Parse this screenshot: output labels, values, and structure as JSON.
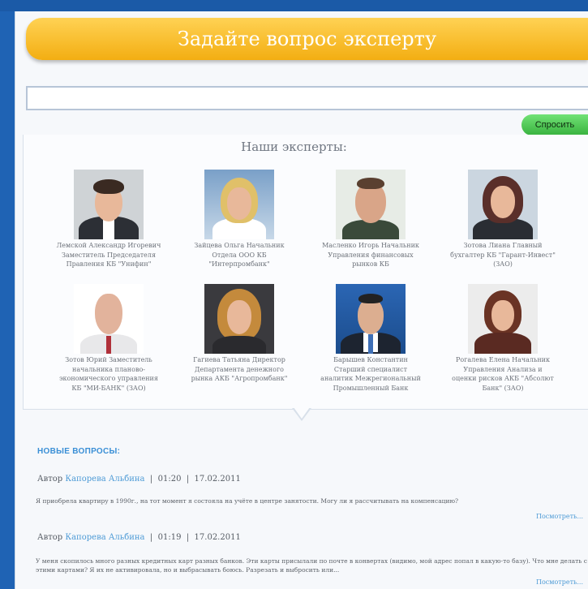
{
  "header": {
    "title": "Задайте вопрос эксперту"
  },
  "search": {
    "placeholder": "",
    "ask_label": "Спросить"
  },
  "experts_section": {
    "heading": "Наши эксперты:"
  },
  "experts": [
    {
      "caption": "Лемской Александр Игоревич Заместитель Председателя Правления КБ \"Унифин\""
    },
    {
      "caption": "Зайцева Ольга Начальник Отдела ООО КБ \"Интерпромбанк\""
    },
    {
      "caption": "Масленко Игорь Начальник Управления финансовых рынков КБ"
    },
    {
      "caption": "Зотова Лиана Главный бухгалтер КБ \"Гарант-Инвест\"(ЗАО)"
    },
    {
      "caption": "Зотов Юрий Заместитель начальника планово-экономического управления КБ \"МИ-БАНК\" (ЗАО)"
    },
    {
      "caption": "Гагиева Татьяна Директор Департамента денежного рынка АКБ \"Агропромбанк\""
    },
    {
      "caption": "Барышев Константин Старший специалист аналитик Межрегиональный Промышленный Банк"
    },
    {
      "caption": "Рогалева Елена Начальник Управления Анализа и оценки рисков АКБ \"Абсолют Банк\" (ЗАО)"
    }
  ],
  "questions": {
    "title": "НОВЫЕ ВОПРОСЫ:",
    "items": [
      {
        "author_label": "Автор",
        "author": "Капорева Альбина",
        "time": "01:20",
        "date": "17.02.2011",
        "text": "Я приобрела квартиру в 1990г., на тот момент я состояла на учёте в центре занятости. Могу ли я рассчитывать на компенсацию?",
        "more": "Посмотреть..."
      },
      {
        "author_label": "Автор",
        "author": "Капорева Альбина",
        "time": "01:19",
        "date": "17.02.2011",
        "text": "У меня скопилось много разных кредитных карт разных банков. Эти карты присылали по почте в конвертах (видимо, мой адрес попал в какую-то базу). Что мне делать с этими картами? Я их не активировала, но и выбрасывать боюсь. Разрезать и выбросить или...",
        "more": "Посмотреть..."
      }
    ]
  },
  "colors": {
    "frame": "#1f63b4",
    "title_bar": "#f3ae12",
    "ask_button": "#38b23e",
    "link": "#4e9bd6"
  }
}
